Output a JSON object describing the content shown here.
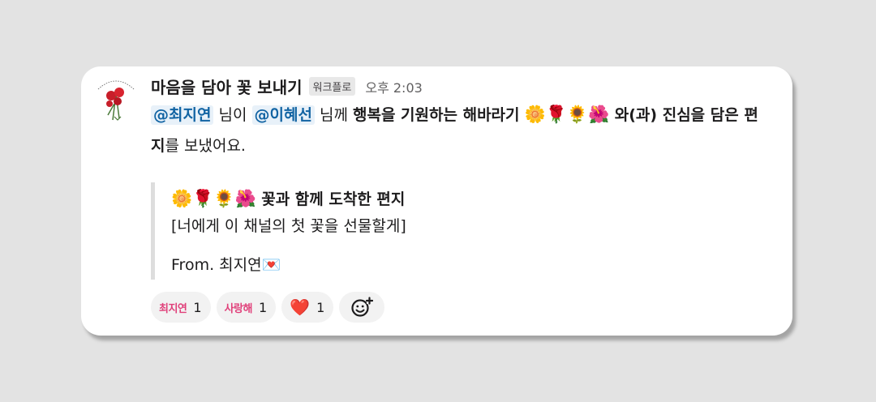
{
  "message": {
    "sender": "마음을 담아 꽃 보내기",
    "badge": "워크플로",
    "time": "오후 2:03",
    "mention1": "@최지연",
    "text1": " 님이 ",
    "mention2": "@이혜선",
    "text2": " 님께 ",
    "bold1": "행복을 기원하는 해바라기",
    "emojis": "🌼🌹🌻🌺",
    "text3": " 와(과) ",
    "bold2": "진심을 담은 편지",
    "text4": "를 보냈어요."
  },
  "attachment": {
    "emojis": "🌼🌹🌻🌺",
    "title": " 꽃과 함께 도착한 편지",
    "quote": "[너에게 이 채널의 첫 꽃을 선물할게]",
    "from": "From. 최지연💌"
  },
  "reactions": [
    {
      "label": "최지연",
      "count": "1"
    },
    {
      "label": "사랑해",
      "count": "1"
    },
    {
      "label": "❤️",
      "count": "1"
    }
  ],
  "icons": {
    "avatar": "carnation-avatar-icon",
    "add_reaction": "add-reaction-icon"
  },
  "colors": {
    "mention": "#1264a3",
    "mention_bg": "#e8f1f9",
    "reaction_pink": "#e0407a"
  }
}
